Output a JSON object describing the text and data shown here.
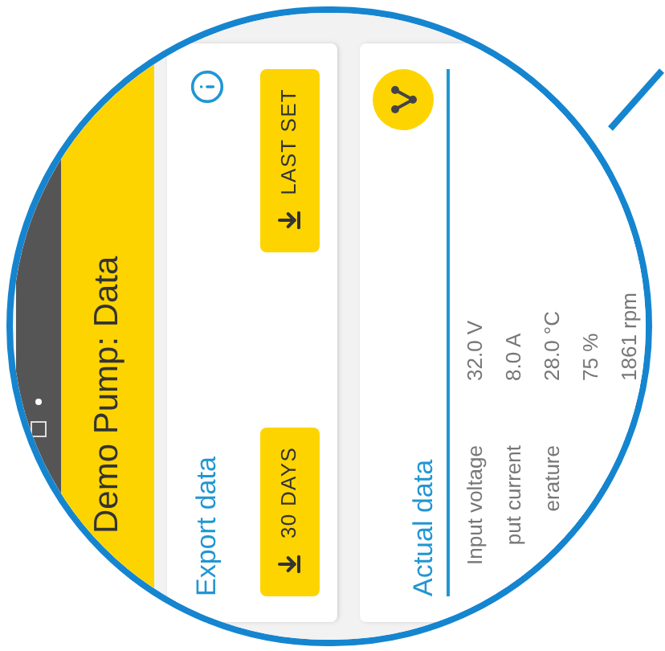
{
  "title": "Demo Pump: Data",
  "export_card": {
    "title": "Export data",
    "buttons": [
      {
        "label": "30 DAYS"
      },
      {
        "label": "LAST SET"
      }
    ]
  },
  "actual_card": {
    "title": "Actual data",
    "rows": [
      {
        "label": "Input voltage",
        "value": "32.0 V"
      },
      {
        "label": "put current",
        "value": "8.0 A"
      },
      {
        "label": "erature",
        "value": "28.0 °C"
      },
      {
        "value": "75 %"
      },
      {
        "value": "1861 rpm"
      }
    ]
  }
}
